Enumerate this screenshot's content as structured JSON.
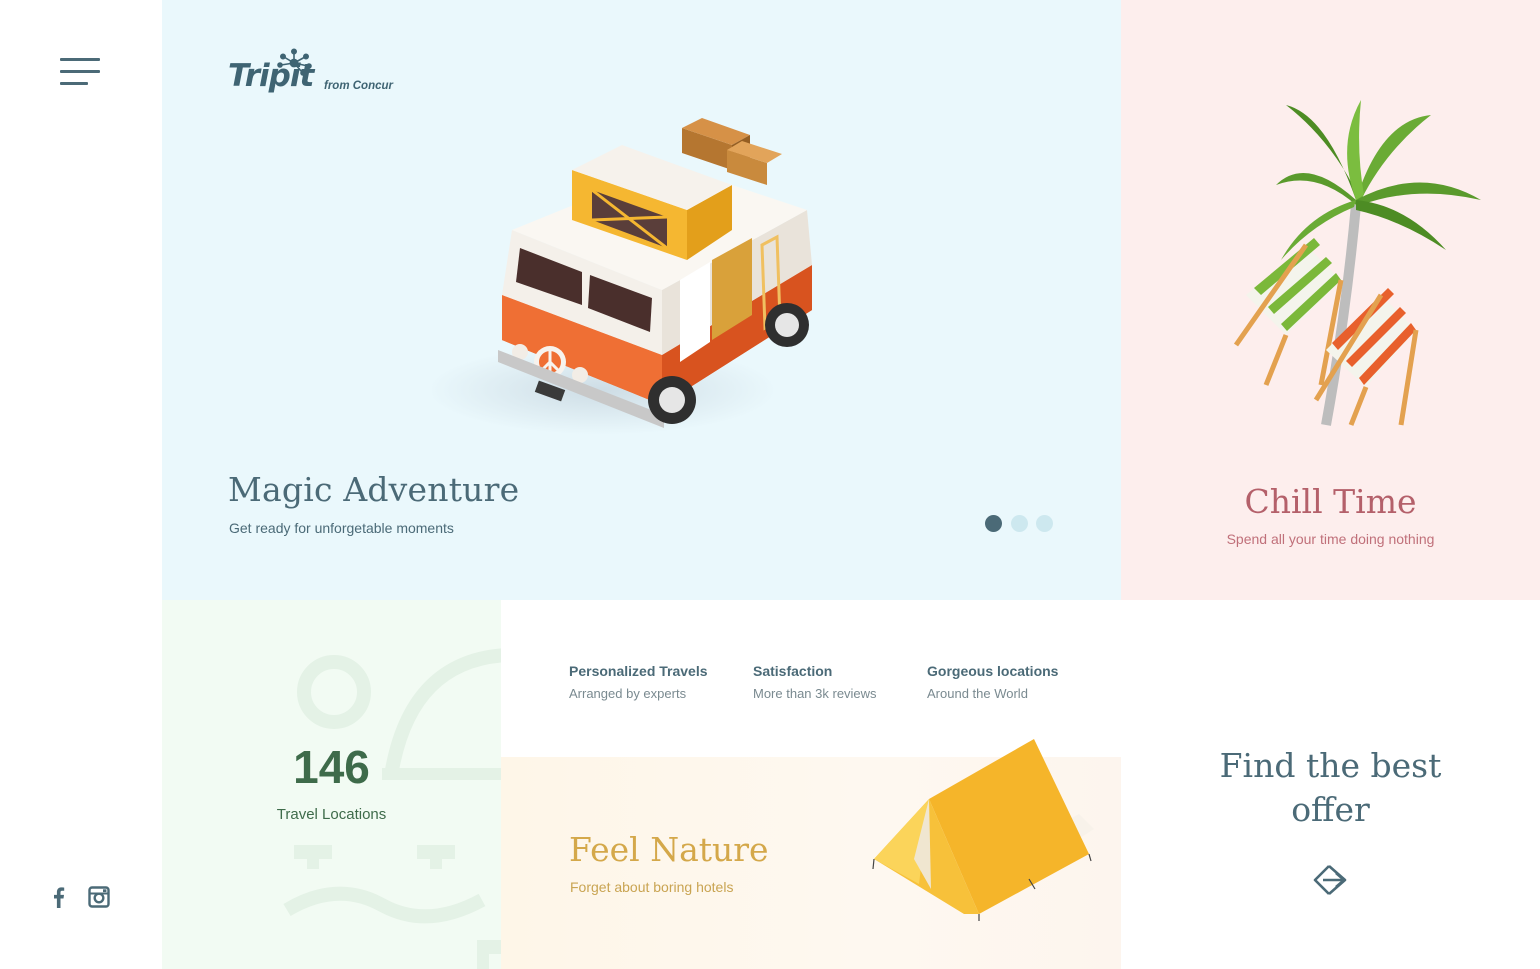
{
  "brand": {
    "logo_word": "Tripit",
    "logo_suffix": "from Concur"
  },
  "sidebar": {
    "menu_icon": "hamburger-menu-icon",
    "social": [
      "facebook-icon",
      "instagram-icon"
    ]
  },
  "hero": {
    "title": "Magic Adventure",
    "subtitle": "Get ready for unforgetable moments",
    "carousel": {
      "count": 3,
      "active": 0
    }
  },
  "chill": {
    "title": "Chill Time",
    "subtitle": "Spend all your time doing nothing"
  },
  "locations": {
    "count": "146",
    "label": "Travel Locations"
  },
  "features": [
    {
      "title": "Personalized Travels",
      "subtitle": "Arranged by experts"
    },
    {
      "title": "Satisfaction",
      "subtitle": "More than 3k reviews"
    },
    {
      "title": "Gorgeous locations",
      "subtitle": "Around the World"
    }
  ],
  "nature": {
    "title": "Feel Nature",
    "subtitle": "Forget about boring hotels"
  },
  "offer": {
    "title_line1": "Find the best",
    "title_line2": "offer",
    "arrow_icon": "arrow-right-icon"
  },
  "colors": {
    "hero_bg": "#eaf8fc",
    "chill_bg": "#fdeeed",
    "locations_bg": "#f2fbf3",
    "primary_text": "#4b6a77",
    "chill_accent": "#b4606a",
    "nature_accent": "#d4a84a",
    "locations_accent": "#3e6b4a"
  }
}
